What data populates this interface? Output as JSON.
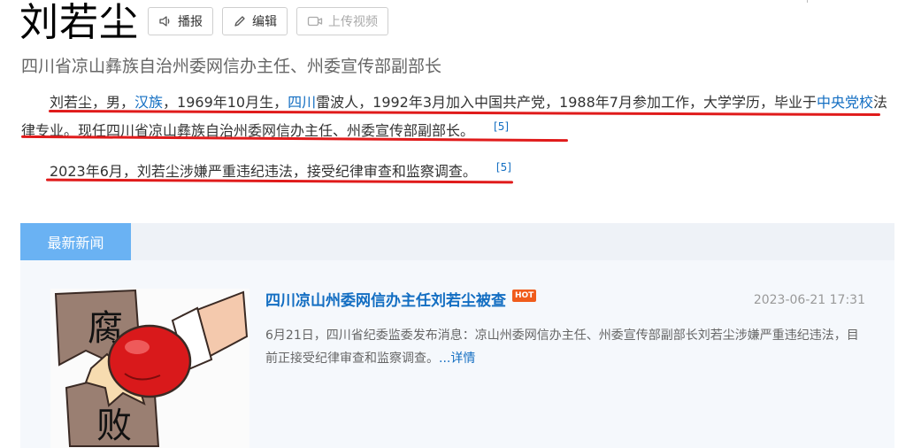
{
  "header": {
    "title": "刘若尘",
    "buttons": {
      "play_label": "播报",
      "edit_label": "编辑",
      "upload_video_label": "上传视频"
    },
    "subtitle": "四川省凉山彝族自治州委网信办主任、州委宣传部副部长"
  },
  "intro": {
    "p1": {
      "s1": "刘若尘，男，",
      "link_ethnicity": "汉族",
      "s2": "，1969年10月生，",
      "link_province": "四川",
      "s3": "雷波人，1992年3月加入中国共产党，1988年7月参加工作，大学学历，毕业于",
      "link_school": "中央党校",
      "s4": "法律专业。现任四川省凉山彝族自治州委网信办主任、州委宣传部副部长。",
      "ref": "[5]"
    },
    "p2": {
      "text": "2023年6月，刘若尘涉嫌严重违纪违法，接受纪律审查和监察调查。",
      "ref": "[5]"
    },
    "underline_color": "#e01b1b"
  },
  "news": {
    "tab_label": "最新新闻",
    "tab_color": "#6ab2f3",
    "item": {
      "title": "四川凉山州委网信办主任刘若尘被查",
      "badge": "HOT",
      "time": "2023-06-21 17:31",
      "summary": "6月21日，四川省纪委监委发布消息：凉山州委网信办主任、州委宣传部副部长刘若尘涉嫌严重违纪违法，目前正接受纪律审查和监察调查。",
      "more": "...详情",
      "thumb": {
        "char_top": "腐",
        "char_bottom": "败",
        "icon": "boxing-glove-icon"
      }
    }
  },
  "colors": {
    "link": "#136ec2",
    "hot": "#f05c1c"
  }
}
